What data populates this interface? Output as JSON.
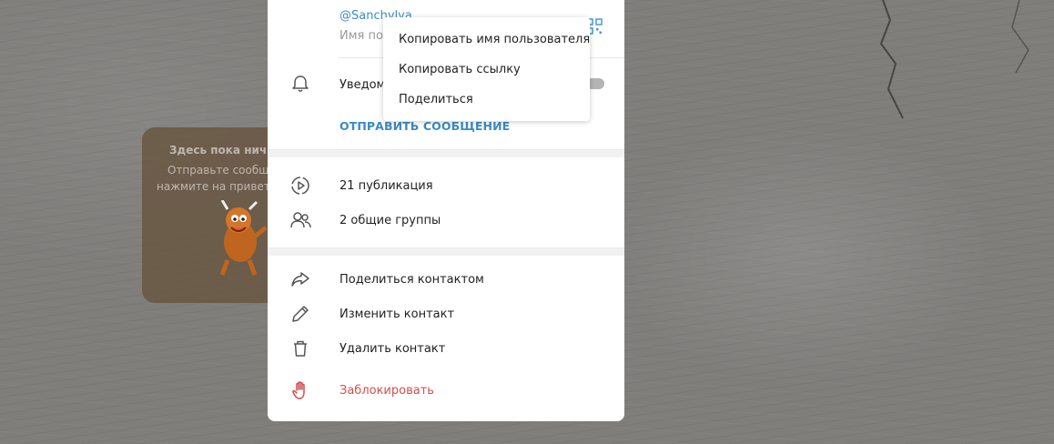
{
  "empty_chat": {
    "title": "Здесь пока нич",
    "line1": "Отправьте сообщ",
    "line2": "нажмите на привет"
  },
  "profile": {
    "username": "@Sanchylya",
    "username_caption": "Имя пол",
    "notifications_label": "Уведом",
    "notifications_enabled": false,
    "send_message": "ОТПРАВИТЬ СООБЩЕНИЕ",
    "publications": "21 публикация",
    "common_groups": "2 общие группы",
    "share_contact": "Поделиться контактом",
    "edit_contact": "Изменить контакт",
    "delete_contact": "Удалить контакт",
    "block": "Заблокировать"
  },
  "context_menu": {
    "items": [
      "Копировать имя пользователя",
      "Копировать ссылку",
      "Поделиться"
    ]
  },
  "colors": {
    "accent": "#3a8ac5",
    "danger": "#d14e4e"
  }
}
